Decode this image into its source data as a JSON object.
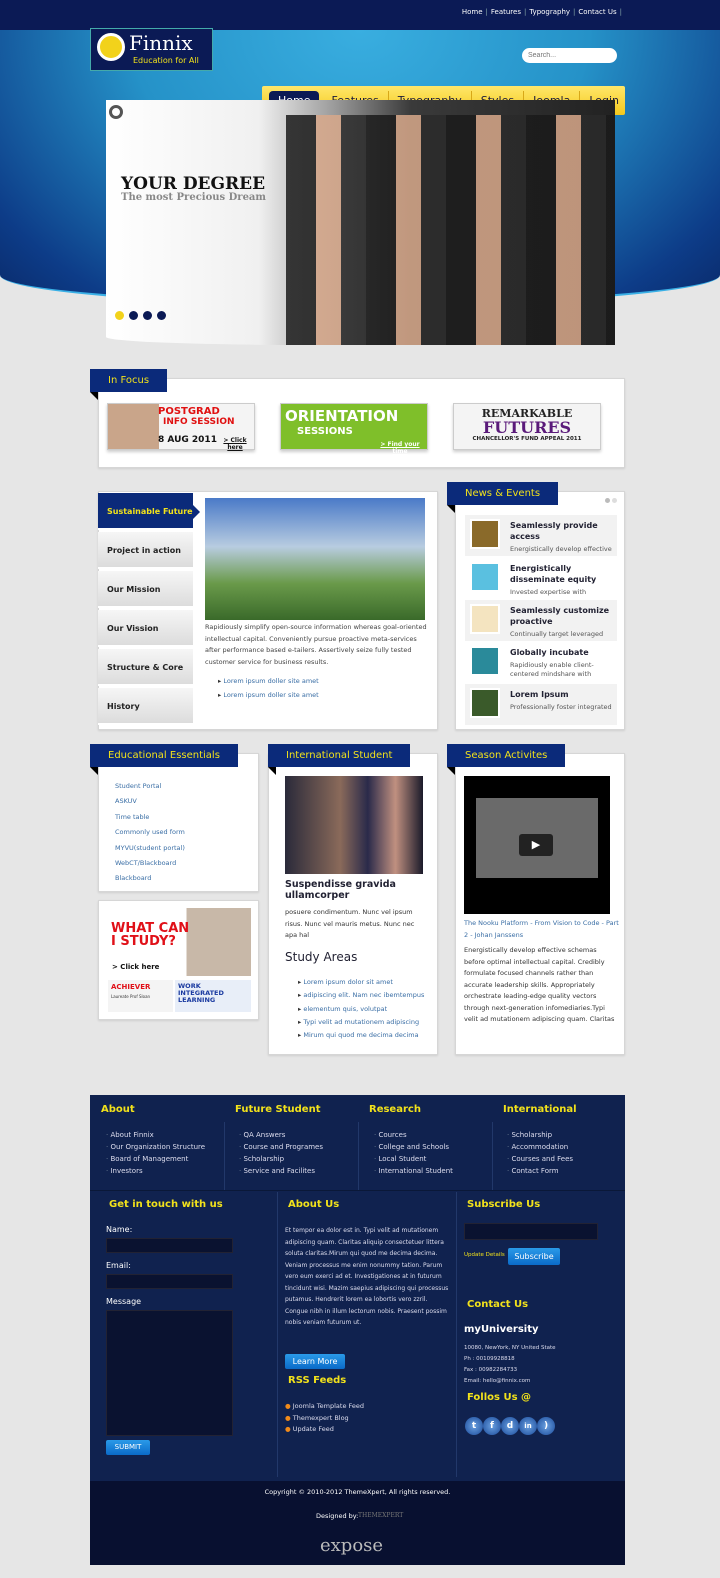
{
  "top_links": [
    "Home",
    "Features",
    "Typography",
    "Contact Us"
  ],
  "logo": {
    "name": "Finnix",
    "tagline": "Education for All"
  },
  "search": {
    "placeholder": "Search..."
  },
  "nav": [
    "Home",
    "Features",
    "Typography",
    "Styles",
    "Joomla",
    "Login"
  ],
  "slider": {
    "title": "YOUR DEGREE",
    "subtitle": "The most Precious Dream",
    "slides": 4,
    "active_slide": 1
  },
  "in_focus": {
    "title": "In Focus",
    "banners": [
      {
        "line1": "POSTGRAD",
        "line2": "INFO SESSION",
        "line3": "8 AUG 2011",
        "cta": "> Click here"
      },
      {
        "line1": "ORIENTATION",
        "line2": "SESSIONS",
        "cta": "> Find your time"
      },
      {
        "line1": "REMARKABLE",
        "line2": "FUTURES",
        "line3": "CHANCELLOR'S FUND APPEAL 2011"
      }
    ]
  },
  "tabs": {
    "items": [
      "Sustainable Future",
      "Project in action",
      "Our Mission",
      "Our Vission",
      "Structure & Core",
      "History"
    ],
    "content": "Rapidiously simplify open-source information whereas goal-oriented intellectual capital. Conveniently pursue proactive meta-services after performance based e-tailers. Assertively seize fully tested customer service for business results.",
    "links": [
      "Lorem ipsum doller site amet",
      "Lorem ipsum doller site amet"
    ]
  },
  "news": {
    "title": "News & Events",
    "items": [
      {
        "title": "Seamlessly provide access",
        "desc": "Energistically develop effective"
      },
      {
        "title": "Energistically disseminate equity",
        "desc": "Invested expertise with"
      },
      {
        "title": "Seamlessly customize proactive",
        "desc": "Continually target leveraged"
      },
      {
        "title": "Globally incubate",
        "desc": "Rapidiously enable client-centered mindshare with"
      },
      {
        "title": "Lorem Ipsum",
        "desc": "Professionally foster integrated"
      }
    ]
  },
  "essentials": {
    "title": "Educational Essentials",
    "links": [
      "Student Portal",
      "ASKUV",
      "Time table",
      "Commonly used form",
      "MYVU(student portal)",
      "WebCT/Blackboard",
      "Blackboard"
    ]
  },
  "ads": {
    "study": "WHAT CAN I STUDY?",
    "study_cta": "> Click here",
    "achiever": "ACHIEVER",
    "achiever_sub": "Laureate Prof Sloan",
    "work": "WORK INTEGRATED LEARNING"
  },
  "intl": {
    "title": "International Student",
    "heading": "Suspendisse gravida ullamcorper",
    "text": "posuere condimentum. Nunc vel ipsum risus. Nunc vel mauris metus. Nunc nec apa hal",
    "study_title": "Study Areas",
    "study_links": [
      "Lorem ipsum dolor sit amet",
      "adipiscing elit. Nam nec ibemtempus",
      "elementum quis, volutpat",
      "Typi velit ad mutationem adipiscing",
      "Mirum qui quod me decima decima"
    ]
  },
  "season": {
    "title": "Season Activites",
    "video_title": "The Nooku Platform - From Vision to Code - Part 2 - Johan Janssens",
    "text": "Energistically develop effective schemas before optimal intellectual capital. Credibly formulate focused channels rather than accurate leadership skills. Appropriately orchestrate leading-edge quality vectors through next-generation infomediaries.Typi velit ad mutationem adipiscing quam. Claritas"
  },
  "footer": {
    "cols": [
      {
        "title": "About",
        "links": [
          "About Finnix",
          "Our Organization Structure",
          "Board of Management",
          "Investors"
        ]
      },
      {
        "title": "Future Student",
        "links": [
          "QA Answers",
          "Course and Programes",
          "Scholarship",
          "Service and Facilites"
        ]
      },
      {
        "title": "Research",
        "links": [
          "Cources",
          "College and Schools",
          "Local Student",
          "International Student"
        ]
      },
      {
        "title": "International",
        "links": [
          "Scholarship",
          "Accommodation",
          "Courses and Fees",
          "Contact Form"
        ]
      }
    ],
    "contact_form": {
      "title": "Get in touch with us",
      "name": "Name:",
      "email": "Email:",
      "message": "Message",
      "submit": "SUBMIT"
    },
    "about": {
      "title": "About Us",
      "text": "Et tempor ea dolor est in. Typi velit ad mutationem adipiscing quam. Claritas aliquip consectetuer littera soluta claritas.Mirum qui quod me decima decima. Veniam processus me enim nonummy tation. Parum vero eum exerci ad et. Investigationes at in futurum tincidunt wisi. Mazim saepius adipiscing qui processus putamus. Hendrerit lorem ea lobortis vero zzril. Congue nibh in illum lectorum nobis. Praesent possim nobis veniam futurum ut.",
      "button": "Learn More"
    },
    "rss": {
      "title": "RSS Feeds",
      "items": [
        "Joomla Template Feed",
        "Themexpert Blog",
        "Update Feed"
      ]
    },
    "subscribe": {
      "title": "Subscribe Us",
      "update": "Update Details",
      "button": "Subscribe"
    },
    "contact": {
      "title": "Contact Us",
      "org": "myUniversity",
      "address": "10080, NewYork, NY United State",
      "phone": "Ph : 00109928818",
      "fax": "Fax : 00982284733",
      "email": "Email: hello@finnix.com"
    },
    "follow": {
      "title": "Follos Us @",
      "icons": [
        "twitter-icon",
        "facebook-icon",
        "delicious-icon",
        "linkedin-icon",
        "rss-icon"
      ]
    },
    "copyright": "Copyright © 2010-2012 ThemeXpert, All rights reserved.",
    "designed_by": "Designed by:",
    "designer_logo": "THEMEXPERT",
    "powered_logo": "expose"
  }
}
